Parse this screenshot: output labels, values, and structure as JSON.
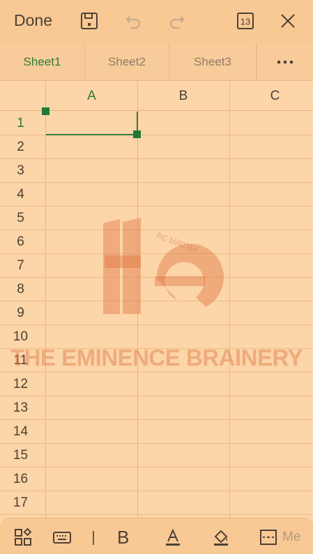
{
  "toolbar": {
    "done_label": "Done",
    "sheet_count": "13"
  },
  "tabs": [
    {
      "label": "Sheet1",
      "active": true
    },
    {
      "label": "Sheet2",
      "active": false
    },
    {
      "label": "Sheet3",
      "active": false
    }
  ],
  "columns": [
    "A",
    "B",
    "C"
  ],
  "rows": [
    "1",
    "2",
    "3",
    "4",
    "5",
    "6",
    "7",
    "8",
    "9",
    "10",
    "11",
    "12",
    "13",
    "14",
    "15",
    "16",
    "17"
  ],
  "selected_cell": "A1",
  "watermark": {
    "text": "THE EMINENCE BRAINERY",
    "rc_text": "RC 1692314"
  },
  "bottom_toolbar": {
    "bold_label": "B",
    "more_label": "Me"
  },
  "colors": {
    "accent": "#2e7d3a",
    "background": "#fcd5a8"
  }
}
